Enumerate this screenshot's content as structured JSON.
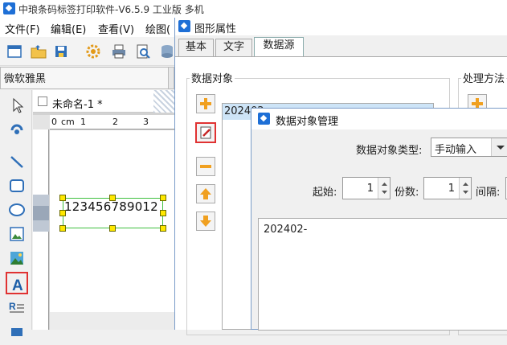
{
  "app": {
    "title": "中琅条码标签打印软件-V6.5.9 工业版 多机",
    "menu": [
      "文件(F)",
      "编辑(E)",
      "查看(V)",
      "绘图("
    ],
    "font_select": "微软雅黑",
    "document_tab": "未命名-1 *",
    "ruler_unit": "cm",
    "ruler_ticks": [
      "0",
      "1",
      "2",
      "3"
    ],
    "barcode_text": "123456789012",
    "toolbar_icons": [
      "new-file-icon",
      "open-folder-icon",
      "save-icon",
      "settings-gear-icon",
      "print-icon",
      "print-preview-icon",
      "database-icon"
    ],
    "left_tools": [
      "pointer-icon",
      "pan-icon",
      "line-icon",
      "rectangle-icon",
      "ellipse-icon",
      "image-icon",
      "picture-icon",
      "text-icon",
      "rich-text-icon",
      "barcode-icon"
    ]
  },
  "graphic_properties": {
    "title": "图形属性",
    "tabs": [
      "基本",
      "文字",
      "数据源"
    ],
    "active_tab": "数据源",
    "data_objects_label": "数据对象",
    "processing_label": "处理方法",
    "data_items": [
      "202402-"
    ],
    "side_buttons": [
      "add-icon",
      "edit-icon",
      "remove-icon",
      "move-up-icon",
      "move-down-icon"
    ]
  },
  "data_object_manager": {
    "title": "数据对象管理",
    "type_label": "数据对象类型:",
    "type_value": "手动输入",
    "start_label": "起始:",
    "start_value": "1",
    "copies_label": "份数:",
    "copies_value": "1",
    "interval_label": "间隔:",
    "content": "202402-"
  },
  "colors": {
    "accent": "#1e6fd6",
    "selection_box": "#40c040",
    "handle": "#ffe800",
    "highlight_red": "#e03232",
    "list_selection": "#cde4f7"
  }
}
